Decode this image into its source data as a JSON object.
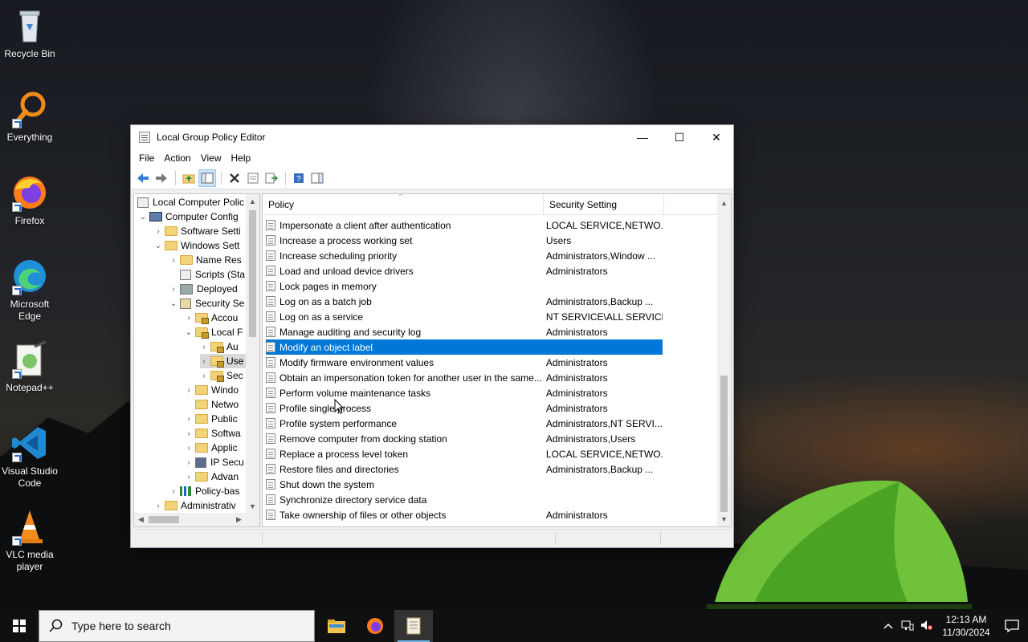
{
  "desktop": {
    "icons": [
      {
        "label": "Recycle Bin"
      },
      {
        "label": "Everything"
      },
      {
        "label": "Firefox"
      },
      {
        "label": "Microsoft Edge"
      },
      {
        "label": "Notepad++"
      },
      {
        "label": "Visual Studio Code"
      },
      {
        "label": "VLC media player"
      }
    ]
  },
  "window": {
    "title": "Local Group Policy Editor",
    "controls": {
      "minimize": "—",
      "maximize": "☐",
      "close": "✕"
    },
    "menu": [
      "File",
      "Action",
      "View",
      "Help"
    ]
  },
  "tree": {
    "items": [
      {
        "label": "Local Computer Polic"
      },
      {
        "label": "Computer Config"
      },
      {
        "label": "Software Setti"
      },
      {
        "label": "Windows Sett"
      },
      {
        "label": "Name Res"
      },
      {
        "label": "Scripts (Sta"
      },
      {
        "label": "Deployed"
      },
      {
        "label": "Security Se"
      },
      {
        "label": "Accou"
      },
      {
        "label": "Local F"
      },
      {
        "label": "Au"
      },
      {
        "label": "Use"
      },
      {
        "label": "Sec"
      },
      {
        "label": "Windo"
      },
      {
        "label": "Netwo"
      },
      {
        "label": "Public"
      },
      {
        "label": "Softwa"
      },
      {
        "label": "Applic"
      },
      {
        "label": "IP Secu"
      },
      {
        "label": "Advan"
      },
      {
        "label": "Policy-bas"
      },
      {
        "label": "Administrativ"
      }
    ]
  },
  "list": {
    "columns": {
      "policy": "Policy",
      "setting": "Security Setting"
    },
    "rows": [
      {
        "policy": "Impersonate a client after authentication",
        "setting": "LOCAL SERVICE,NETWO..."
      },
      {
        "policy": "Increase a process working set",
        "setting": "Users"
      },
      {
        "policy": "Increase scheduling priority",
        "setting": "Administrators,Window ..."
      },
      {
        "policy": "Load and unload device drivers",
        "setting": "Administrators"
      },
      {
        "policy": "Lock pages in memory",
        "setting": ""
      },
      {
        "policy": "Log on as a batch job",
        "setting": "Administrators,Backup ..."
      },
      {
        "policy": "Log on as a service",
        "setting": "NT SERVICE\\ALL SERVICES"
      },
      {
        "policy": "Manage auditing and security log",
        "setting": "Administrators"
      },
      {
        "policy": "Modify an object label",
        "setting": ""
      },
      {
        "policy": "Modify firmware environment values",
        "setting": "Administrators"
      },
      {
        "policy": "Obtain an impersonation token for another user in the same...",
        "setting": "Administrators"
      },
      {
        "policy": "Perform volume maintenance tasks",
        "setting": "Administrators"
      },
      {
        "policy": "Profile single process",
        "setting": "Administrators"
      },
      {
        "policy": "Profile system performance",
        "setting": "Administrators,NT SERVI..."
      },
      {
        "policy": "Remove computer from docking station",
        "setting": "Administrators,Users"
      },
      {
        "policy": "Replace a process level token",
        "setting": "LOCAL SERVICE,NETWO..."
      },
      {
        "policy": "Restore files and directories",
        "setting": "Administrators,Backup ..."
      },
      {
        "policy": "Shut down the system",
        "setting": ""
      },
      {
        "policy": "Synchronize directory service data",
        "setting": ""
      },
      {
        "policy": "Take ownership of files or other objects",
        "setting": "Administrators"
      }
    ],
    "selected_index": 8
  },
  "taskbar": {
    "search_placeholder": "Type here to search",
    "time": "12:13 AM",
    "date": "11/30/2024"
  },
  "colors": {
    "selection": "#0078d7",
    "taskbar": "#101010"
  }
}
